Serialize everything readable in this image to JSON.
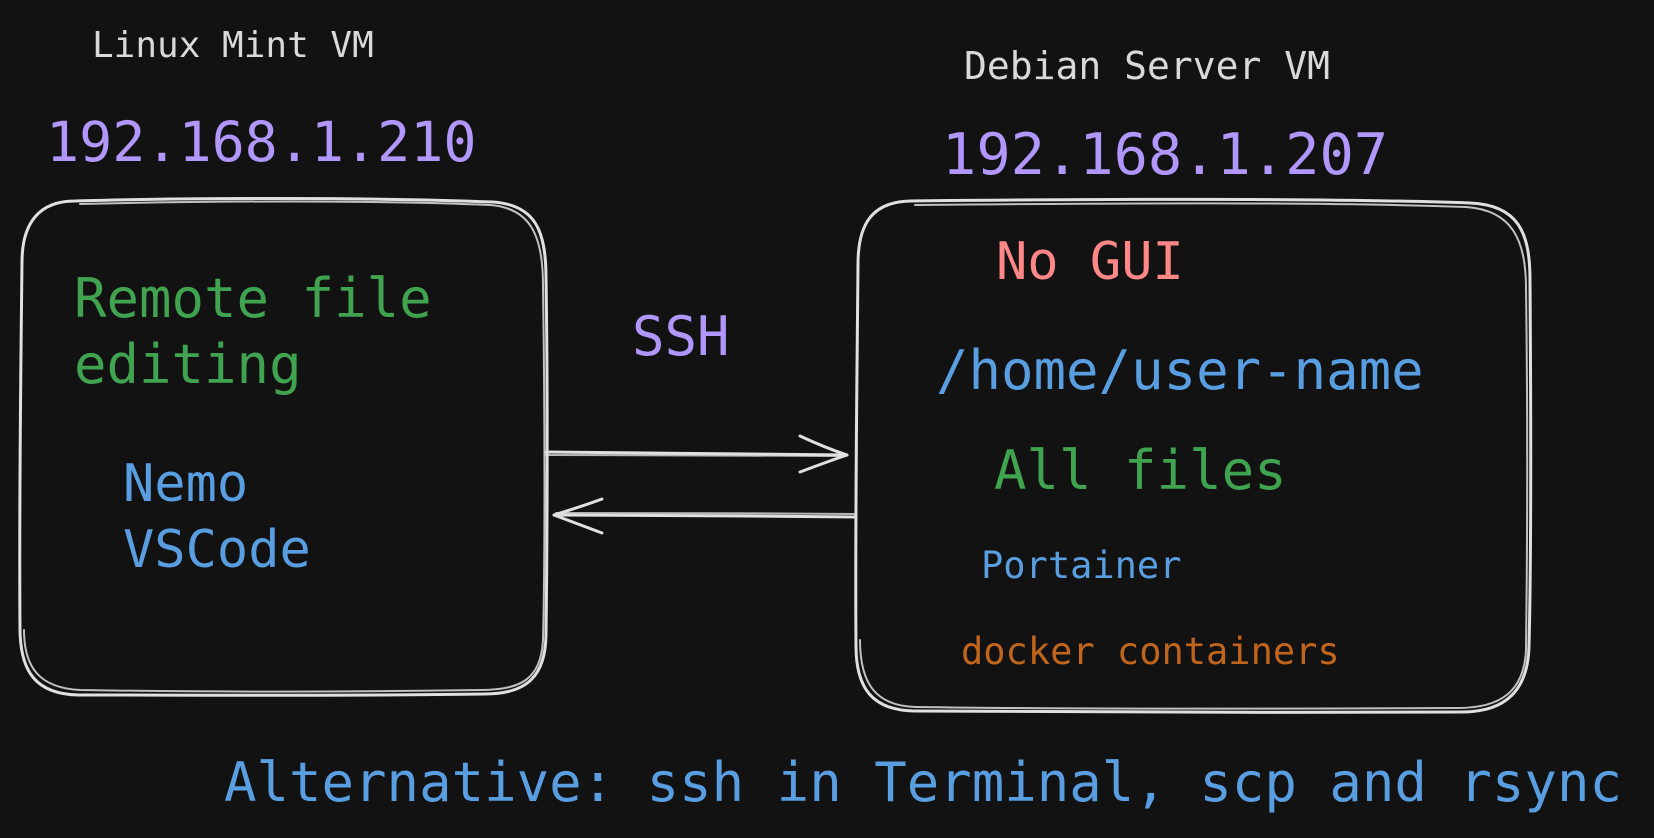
{
  "colors": {
    "background": "#121212",
    "stroke": "#e0e0e0",
    "label": "#d9d9d9",
    "purple": "#b197fc",
    "green": "#40a350",
    "blue": "#5a9ee2",
    "red": "#ff8787",
    "orange": "#c0651b"
  },
  "left_vm": {
    "title": "Linux Mint VM",
    "ip": "192.168.1.210",
    "line1": "Remote file",
    "line2": "editing",
    "app1": "Nemo",
    "app2": "VSCode"
  },
  "right_vm": {
    "title": "Debian Server VM",
    "ip": "192.168.1.207",
    "no_gui": "No GUI",
    "home_path": "/home/user-name",
    "all_files": "All files",
    "portainer": "Portainer",
    "docker": "docker containers"
  },
  "connection": {
    "label": "SSH"
  },
  "footer": {
    "alternative": "Alternative: ssh in Terminal, scp and rsync"
  }
}
